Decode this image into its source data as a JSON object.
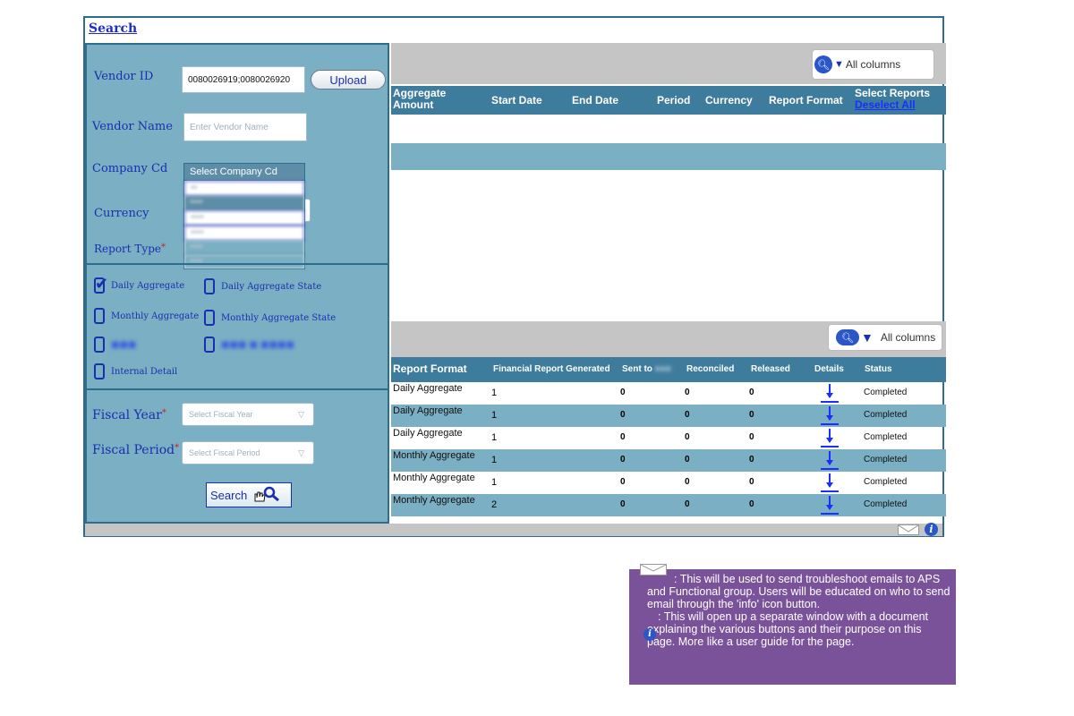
{
  "header": {
    "search_link": "Search"
  },
  "form": {
    "vendor_id_label": "Vendor ID",
    "vendor_id_value": "0080026919;0080026920",
    "upload_label": "Upload",
    "vendor_name_label": "Vendor Name",
    "vendor_name_placeholder": "Enter Vendor Name",
    "company_cd_label": "Company Cd",
    "company_cd_selected": "Select Company Cd",
    "currency_label": "Currency",
    "report_type_label": "Report Type",
    "required_mark": "*",
    "fiscal_year_label": "Fiscal Year",
    "fiscal_year_placeholder": "Select Fiscal Year",
    "fiscal_period_label": "Fiscal Period",
    "fiscal_period_placeholder": "Select Fiscal Period",
    "search_button": "Search"
  },
  "report_types": [
    {
      "label": "Daily Aggregate",
      "checked": true
    },
    {
      "label": "Daily Aggregate State",
      "checked": false
    },
    {
      "label": "Monthly Aggregate",
      "checked": false
    },
    {
      "label": "Monthly Aggregate State",
      "checked": false
    },
    {
      "label": "",
      "checked": false
    },
    {
      "label": "",
      "checked": false
    },
    {
      "label": "Internal Detail",
      "checked": false
    }
  ],
  "top_grid": {
    "all_columns_label": "All columns",
    "columns": [
      "Aggregate Amount",
      "Start Date",
      "End Date",
      "Period",
      "Currency",
      "Report Format",
      "Select Reports"
    ],
    "deselect_all": "Deselect All"
  },
  "bottom_grid": {
    "all_columns_label": "All columns",
    "columns": [
      "Report Format",
      "Financial Report Generated",
      "Sent to",
      "Reconciled",
      "Released",
      "Details",
      "Status"
    ],
    "rows": [
      {
        "format": "Daily Aggregate",
        "generated": "1",
        "sent": "0",
        "reconciled": "0",
        "released": "0",
        "status": "Completed"
      },
      {
        "format": "Daily Aggregate",
        "generated": "1",
        "sent": "0",
        "reconciled": "0",
        "released": "0",
        "status": "Completed"
      },
      {
        "format": "Daily Aggregate",
        "generated": "1",
        "sent": "0",
        "reconciled": "0",
        "released": "0",
        "status": "Completed"
      },
      {
        "format": "Monthly Aggregate",
        "generated": "1",
        "sent": "0",
        "reconciled": "0",
        "released": "0",
        "status": "Completed"
      },
      {
        "format": "Monthly Aggregate",
        "generated": "1",
        "sent": "0",
        "reconciled": "0",
        "released": "0",
        "status": "Completed"
      },
      {
        "format": "Monthly Aggregate",
        "generated": "2",
        "sent": "0",
        "reconciled": "0",
        "released": "0",
        "status": "Completed"
      }
    ]
  },
  "note": {
    "mail_text": ": This will be used to send troubleshoot emails to APS and Functional group. Users will be educated on who to send email through the 'info' icon button.",
    "info_text": ": This will open up a separate window with a document explaining the various buttons and their purpose on this page. More like a user guide for the page."
  },
  "colors": {
    "panel": "#7bafc3",
    "header": "#3e7c9e",
    "accent": "#1a2fb0",
    "note": "#7a529a"
  }
}
